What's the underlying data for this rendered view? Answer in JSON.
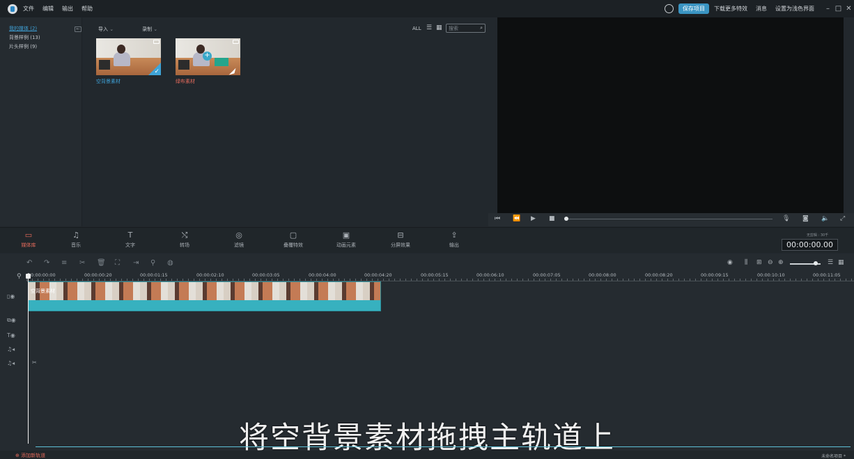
{
  "menubar": {
    "menus": [
      "文件",
      "编辑",
      "输出",
      "帮助"
    ],
    "save_project": "保存项目",
    "download_effects": "下载更多特效",
    "messages": "消息",
    "settings": "设置为浅色界面"
  },
  "library": {
    "items": [
      {
        "label": "我的媒体 (2)",
        "active": true
      },
      {
        "label": "背景样例 (13)",
        "active": false
      },
      {
        "label": "片头样例 (9)",
        "active": false
      }
    ]
  },
  "media_toolbar": {
    "import_label": "导入",
    "record_label": "录制",
    "filter_all": "ALL",
    "search_placeholder": "搜索"
  },
  "media_items": [
    {
      "label": "空背景素材",
      "label_color": "#3fa2d8",
      "selected": true
    },
    {
      "label": "绿布素材",
      "label_color": "#e36a5b",
      "selected": false
    }
  ],
  "func_tabs": [
    {
      "label": "媒体库",
      "icon": "folder-icon",
      "active": true
    },
    {
      "label": "音乐",
      "icon": "music-icon",
      "active": false
    },
    {
      "label": "文字",
      "icon": "text-icon",
      "active": false
    },
    {
      "label": "转场",
      "icon": "transition-icon",
      "active": false
    },
    {
      "label": "滤镜",
      "icon": "filter-icon",
      "active": false
    },
    {
      "label": "叠覆特效",
      "icon": "overlay-icon",
      "active": false
    },
    {
      "label": "动画元素",
      "icon": "image-icon",
      "active": false
    },
    {
      "label": "分屏效果",
      "icon": "split-screen-icon",
      "active": false
    },
    {
      "label": "输出",
      "icon": "export-icon",
      "active": false
    }
  ],
  "timecode": {
    "caption": "无剪辑 : 30千",
    "value": "00:00:00.00"
  },
  "ruler_labels": [
    "00:00:00:00",
    "00:00:00:20",
    "00:00:01:15",
    "00:00:02:10",
    "00:00:03:05",
    "00:00:04:00",
    "00:00:04:20",
    "00:00:05:15",
    "00:00:06:10",
    "00:00:07:05",
    "00:00:08:00",
    "00:00:08:20",
    "00:00:09:15",
    "00:00:10:10",
    "00:00:11:05"
  ],
  "clip": {
    "name": "空背景素材"
  },
  "subtitle": "将空背景素材拖拽主轨道上",
  "bottom": {
    "add_track": "添加新轨道",
    "project_name": "未命名项目 *"
  },
  "colors": {
    "accent_blue": "#3a94c2",
    "accent_red": "#e36a5b",
    "clip_teal": "#37b1bf"
  }
}
